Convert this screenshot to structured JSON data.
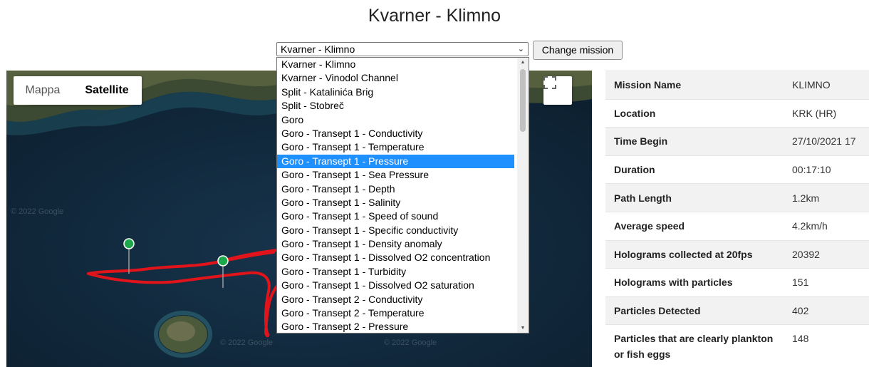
{
  "page": {
    "title": "Kvarner - Klimno"
  },
  "selector": {
    "selected": "Kvarner - Klimno",
    "button_label": "Change mission",
    "options": [
      "Kvarner - Klimno",
      "Kvarner - Vinodol Channel",
      "Split - Katalinića Brig",
      "Split - Stobreč",
      "Goro",
      "Goro - Transept 1 - Conductivity",
      "Goro - Transept 1 - Temperature",
      "Goro - Transept 1 - Pressure",
      "Goro - Transept 1 - Sea Pressure",
      "Goro - Transept 1 - Depth",
      "Goro - Transept 1 - Salinity",
      "Goro - Transept 1 - Speed of sound",
      "Goro - Transept 1 - Specific conductivity",
      "Goro - Transept 1 - Density anomaly",
      "Goro - Transept 1 - Dissolved O2 concentration",
      "Goro - Transept 1 - Turbidity",
      "Goro - Transept 1 - Dissolved O2 saturation",
      "Goro - Transept 2 - Conductivity",
      "Goro - Transept 2 - Temperature",
      "Goro - Transept 2 - Pressure"
    ],
    "highlighted_option": "Goro - Transept 1 - Pressure"
  },
  "map": {
    "type_mappa": "Mappa",
    "type_satellite": "Satellite",
    "watermark": "© 2022 Google",
    "fullscreen_icon": "fullscreen-icon",
    "track_color": "#e0141a",
    "marker_color": "#1fa84b"
  },
  "info": [
    {
      "label": "Mission Name",
      "value": "KLIMNO"
    },
    {
      "label": "Location",
      "value": "KRK (HR)"
    },
    {
      "label": "Time Begin",
      "value": "27/10/2021 17"
    },
    {
      "label": "Duration",
      "value": "00:17:10"
    },
    {
      "label": "Path Length",
      "value": "1.2km"
    },
    {
      "label": "Average speed",
      "value": "4.2km/h"
    },
    {
      "label": "Holograms collected at 20fps",
      "value": "20392"
    },
    {
      "label": "Holograms with particles",
      "value": "151"
    },
    {
      "label": "Particles Detected",
      "value": "402"
    },
    {
      "label": "Particles that are clearly plankton or fish eggs",
      "value": "148"
    }
  ]
}
